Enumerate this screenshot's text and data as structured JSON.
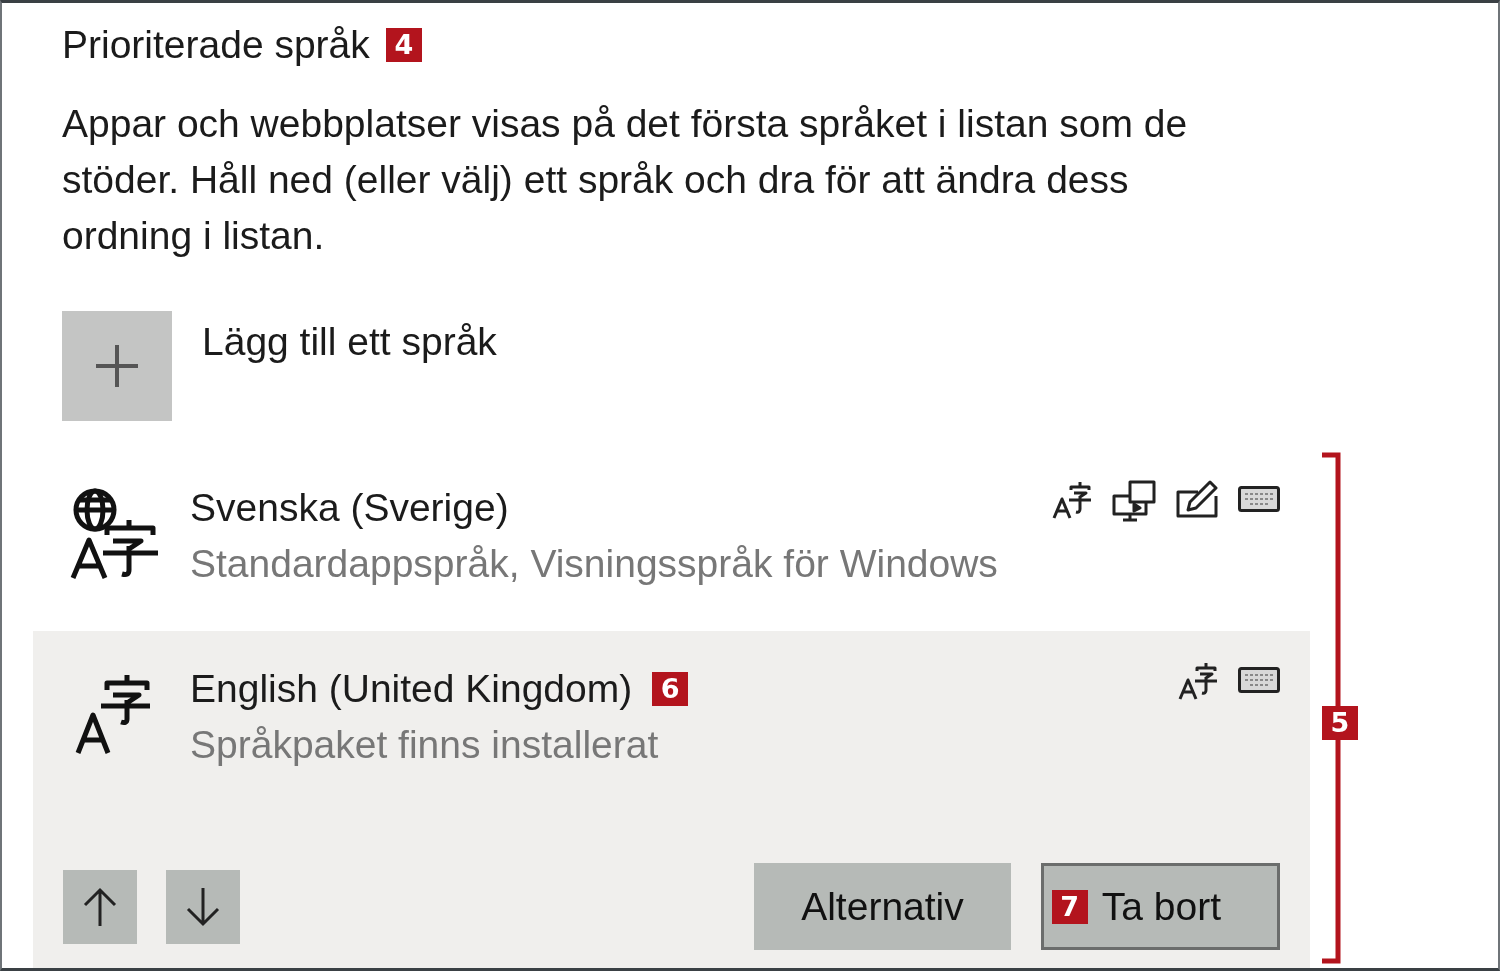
{
  "heading": {
    "text": "Prioriterade språk",
    "callout": "4"
  },
  "description": "Appar och webbplatser visas på det första språket i listan som de stöder. Håll ned (eller välj) ett språk och dra för att ändra dess ordning i listan.",
  "add_language": {
    "label": "Lägg till ett språk"
  },
  "languages": [
    {
      "kind": "display-language",
      "name": "Svenska (Sverige)",
      "status": "Standardappspråk, Visningsspråk för Windows",
      "selected": false,
      "features": [
        {
          "kind": "language-pack"
        },
        {
          "kind": "display"
        },
        {
          "kind": "handwriting"
        },
        {
          "kind": "keyboard"
        }
      ]
    },
    {
      "kind": "language",
      "name": "English (United Kingdom)",
      "callout": "6",
      "status": "Språkpaket finns installerat",
      "selected": true,
      "features": [
        {
          "kind": "language-pack"
        },
        {
          "kind": "keyboard"
        }
      ]
    }
  ],
  "list_callout": "5",
  "selected_actions": {
    "buttons": [
      {
        "label": "Alternativ",
        "focused": false
      },
      {
        "label": "Ta bort",
        "callout": "7",
        "focused": true
      }
    ]
  }
}
